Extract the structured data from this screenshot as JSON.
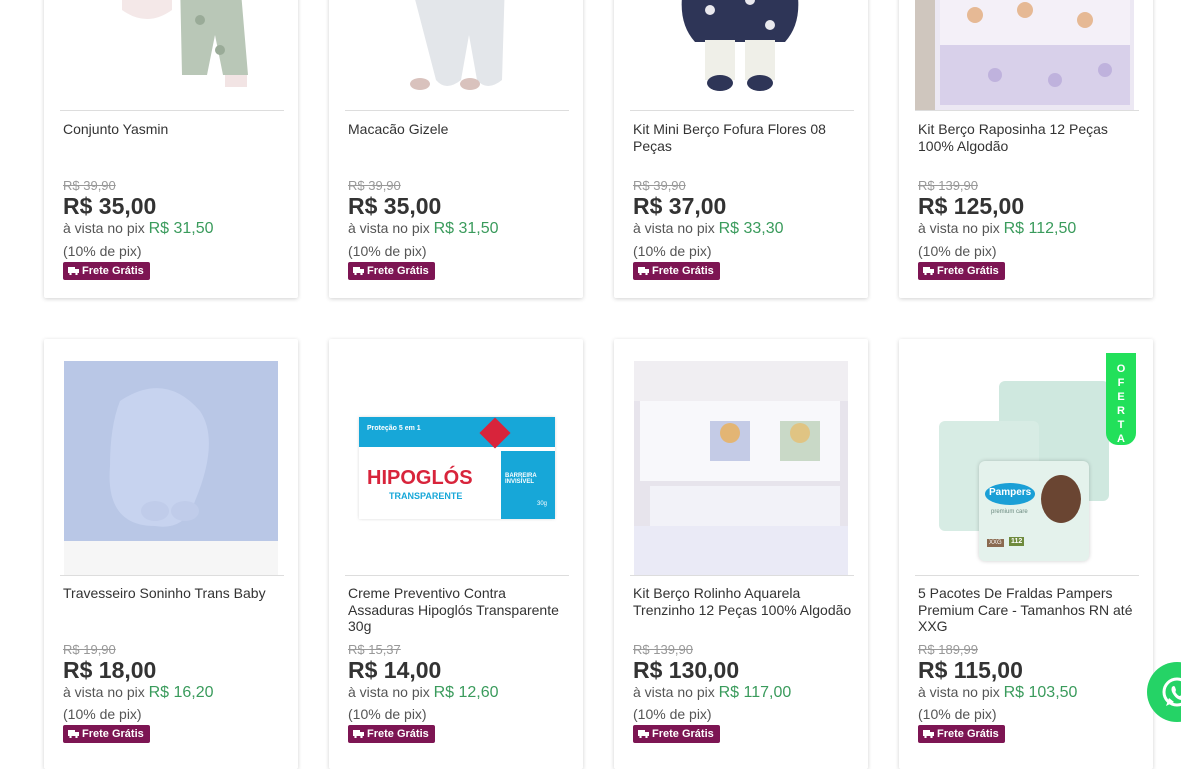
{
  "badge_label": "Frete Grátis",
  "pix_prefix": "à vista no pix",
  "pix_pct": "(10% de pix)",
  "oferta_label": "OFERTA",
  "products_row1": [
    {
      "title": "Conjunto Yasmin",
      "old": "R$ 39,90",
      "price": "R$ 35,00",
      "pix": "R$ 31,50"
    },
    {
      "title": "Macacão Gizele",
      "old": "R$ 39,90",
      "price": "R$ 35,00",
      "pix": "R$ 31,50"
    },
    {
      "title": "Kit Mini Berço Fofura Flores 08 Peças",
      "old": "R$ 39,90",
      "price": "R$ 37,00",
      "pix": "R$ 33,30"
    },
    {
      "title": "Kit Berço Raposinha 12 Peças 100% Algodão",
      "old": "R$ 139,90",
      "price": "R$ 125,00",
      "pix": "R$ 112,50"
    }
  ],
  "products_row2": [
    {
      "title": "Travesseiro Soninho Trans Baby",
      "old": "R$ 19,90",
      "price": "R$ 18,00",
      "pix": "R$ 16,20"
    },
    {
      "title": "Creme Preventivo Contra Assaduras Hipoglós Transparente 30g",
      "old": "R$ 15,37",
      "price": "R$ 14,00",
      "pix": "R$ 12,60"
    },
    {
      "title": "Kit Berço Rolinho Aquarela Trenzinho 12 Peças 100% Algodão",
      "old": "R$ 139,90",
      "price": "R$ 130,00",
      "pix": "R$ 117,00"
    },
    {
      "title": "5 Pacotes De Fraldas Pampers Premium Care - Tamanhos RN até XXG",
      "old": "R$ 189,99",
      "price": "R$ 115,00",
      "pix": "R$ 103,50"
    }
  ],
  "image_text": {
    "hipoglos_top": "Proteção 5 em 1",
    "hipoglos_brand": "HIPOGLÓS",
    "hipoglos_sub": "TRANSPARENTE",
    "hipoglos_side": "BARREIRA INVISÍVEL",
    "hipoglos_size": "30g",
    "pampers_brand": "Pampers",
    "pampers_line": "premium care",
    "pampers_size": "XXG",
    "pampers_count": "112"
  }
}
